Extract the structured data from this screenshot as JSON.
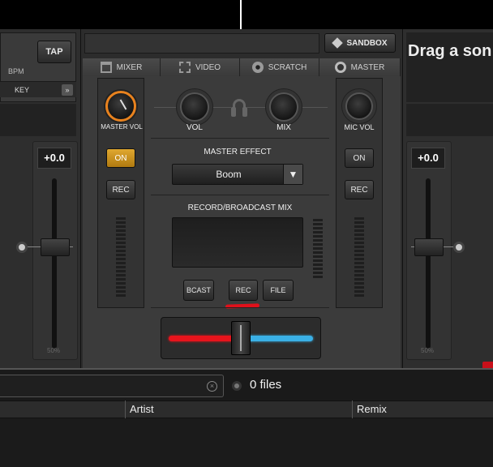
{
  "left_deck": {
    "tap_label": "TAP",
    "bpm_label": "BPM",
    "key_label": "KEY",
    "pitch_readout": "+0.0",
    "pitch_range": "50%",
    "minus_label": "−",
    "plus_label": "+"
  },
  "right_deck": {
    "drag_text": "Drag a son",
    "pitch_readout": "+0.0",
    "pitch_range": "50%",
    "minus_label": "−",
    "plus_label": "+"
  },
  "toolbar": {
    "sandbox_label": "SANDBOX"
  },
  "tabs": [
    {
      "label": "MIXER",
      "icon": "mixer-icon"
    },
    {
      "label": "VIDEO",
      "icon": "film-icon"
    },
    {
      "label": "SCRATCH",
      "icon": "disc-icon"
    },
    {
      "label": "MASTER",
      "icon": "master-icon"
    }
  ],
  "mixer": {
    "master_vol_label": "MASTER VOL",
    "vol_label": "VOL",
    "mix_label": "MIX",
    "mic_vol_label": "MIC VOL",
    "on_left": "ON",
    "rec_left": "REC",
    "on_right": "ON",
    "rec_right": "REC",
    "master_effect_label": "MASTER EFFECT",
    "effect_selected": "Boom",
    "record_broadcast_label": "RECORD/BROADCAST MIX",
    "bcast_label": "BCAST",
    "rec_label": "REC",
    "file_label": "FILE",
    "crossfader_position": 0.5
  },
  "browser": {
    "files_count": "0 files",
    "columns": [
      "Artist",
      "Remix"
    ]
  },
  "colors": {
    "master_knob_accent": "#e8821e",
    "on_button": "#c8901a",
    "crossfader_left": "#e8141c",
    "crossfader_right": "#3ab0e6",
    "annotation": "#e0101a"
  }
}
